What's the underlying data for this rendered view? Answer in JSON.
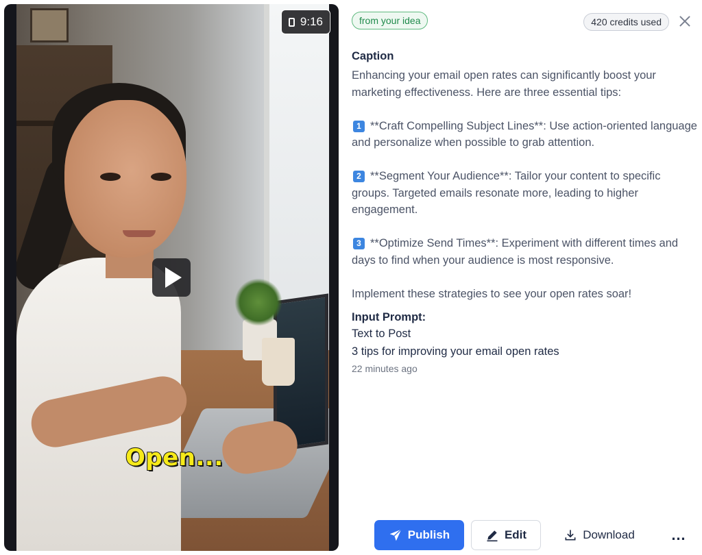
{
  "video": {
    "aspect_ratio": "9:16",
    "subtitle": "Open..."
  },
  "header": {
    "source_badge": "from your idea",
    "credits": "420 credits used"
  },
  "caption": {
    "heading": "Caption",
    "intro": "Enhancing your email open rates can significantly boost your marketing effectiveness. Here are three essential tips:",
    "tips": [
      {
        "number": "1",
        "text": "**Craft Compelling Subject Lines**: Use action-oriented language and personalize when possible to grab attention."
      },
      {
        "number": "2",
        "text": "**Segment Your Audience**: Tailor your content to specific groups. Targeted emails resonate more, leading to higher engagement."
      },
      {
        "number": "3",
        "text": "**Optimize Send Times**: Experiment with different times and days to find when your audience is most responsive."
      }
    ],
    "outro": "Implement these strategies to see your open rates soar!"
  },
  "input_prompt": {
    "heading": "Input Prompt:",
    "type": "Text to Post",
    "text": "3 tips for improving your email open rates",
    "time": "22 minutes ago"
  },
  "actions": {
    "publish": "Publish",
    "edit": "Edit",
    "download": "Download",
    "more": "…"
  },
  "colors": {
    "primary": "#2f6fef",
    "badge_green": "#1f8a4b",
    "subtitle_yellow": "#f6ea1a",
    "tip_number": "#3d86e0"
  },
  "icons": [
    "aspect-ratio-icon",
    "play-icon",
    "close-icon",
    "send-icon",
    "pencil-icon",
    "download-icon",
    "more-icon"
  ]
}
